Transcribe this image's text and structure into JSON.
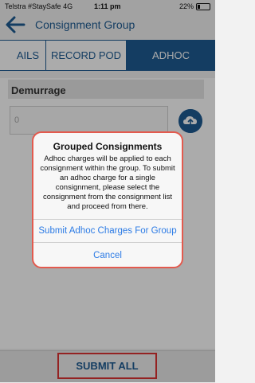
{
  "status_bar": {
    "carrier": "Telstra #StaySafe",
    "network": "4G",
    "time": "1:11 pm",
    "battery_percent": "22%"
  },
  "header": {
    "title": "Consignment Group",
    "back_icon": "arrow-left-icon"
  },
  "tabs": [
    {
      "label": "AILS"
    },
    {
      "label": "RECORD POD"
    },
    {
      "label": "ADHOC CHARGES"
    }
  ],
  "demurrage": {
    "section_label": "Demurrage",
    "value": "0",
    "upload_icon": "cloud-upload-icon"
  },
  "footer": {
    "submit_label": "SUBMIT ALL"
  },
  "dialog": {
    "title": "Grouped Consignments",
    "message": "Adhoc charges will be applied to each consignment within the group. To submit an adhoc charge for a single consignment, please select the consignment from the consignment list and proceed from there.",
    "primary_button": "Submit Adhoc Charges For Group",
    "cancel_button": "Cancel"
  },
  "colors": {
    "brand_blue": "#1f5c93",
    "ios_blue": "#2c7be5",
    "highlight_red": "#e35a4e"
  }
}
